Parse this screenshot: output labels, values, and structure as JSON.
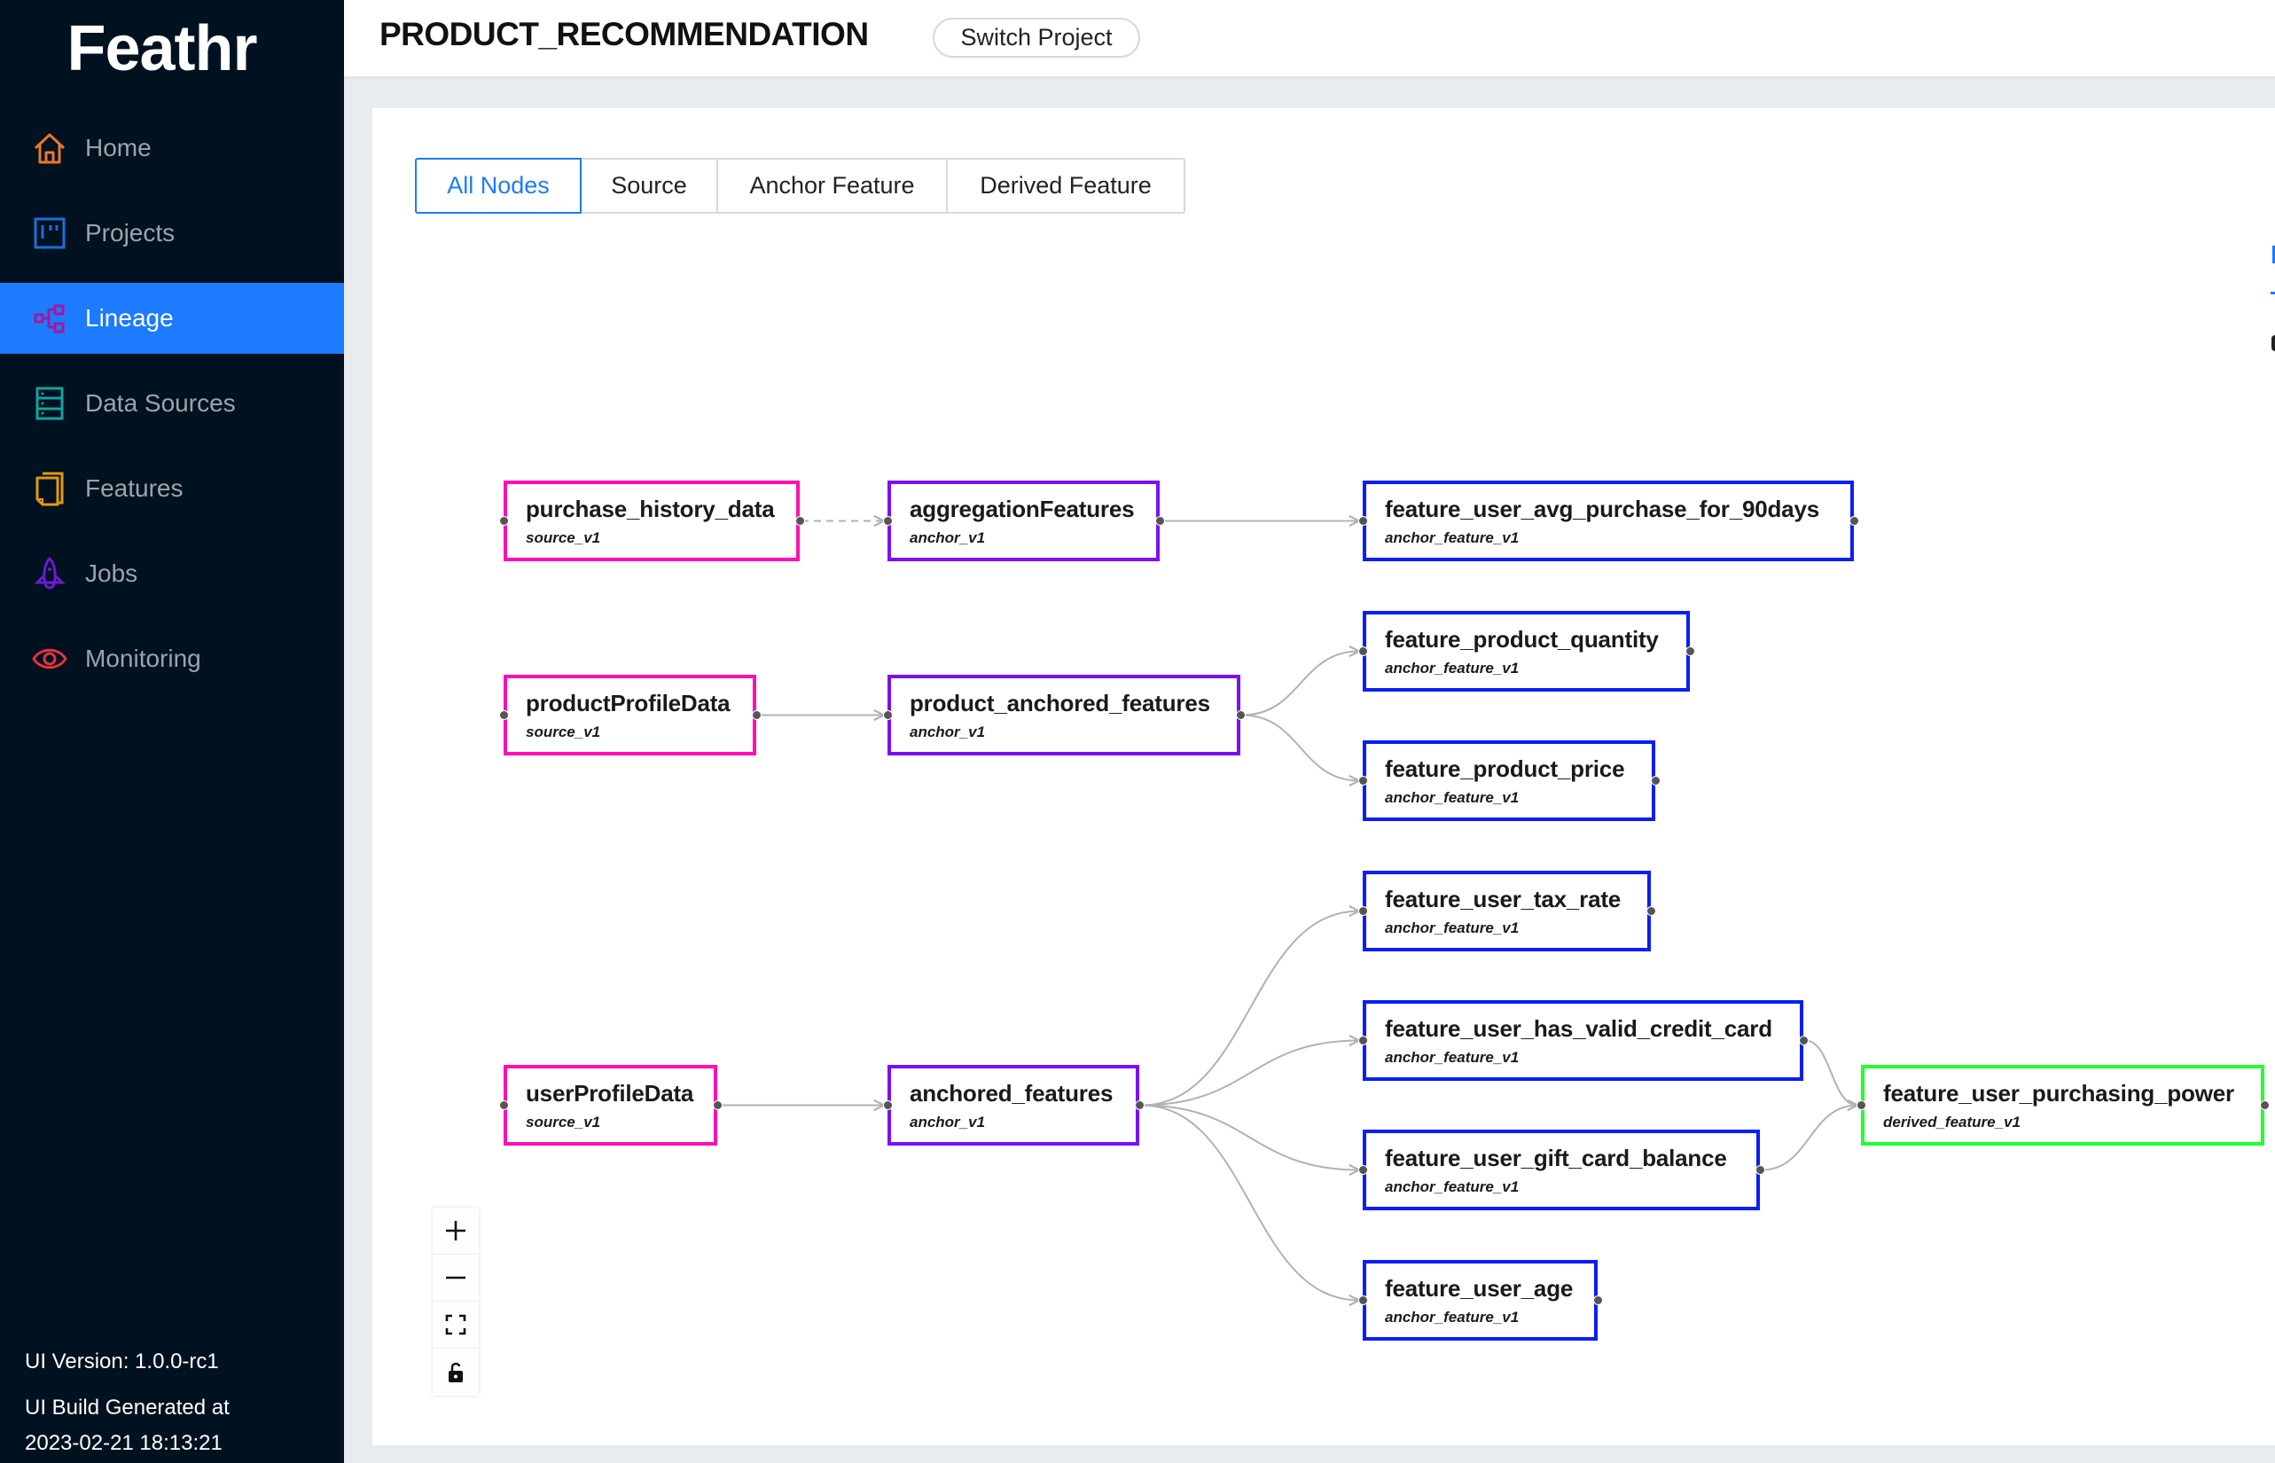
{
  "app": {
    "logo": "Feathr"
  },
  "sidebar": {
    "items": [
      {
        "id": "home",
        "label": "Home",
        "icon": "home-icon",
        "color": "#e8792b",
        "active": false
      },
      {
        "id": "projects",
        "label": "Projects",
        "icon": "projects-board-icon",
        "color": "#1f6fd6",
        "active": false
      },
      {
        "id": "lineage",
        "label": "Lineage",
        "icon": "lineage-icon",
        "color": "#a3199b",
        "active": true
      },
      {
        "id": "data-sources",
        "label": "Data Sources",
        "icon": "database-icon",
        "color": "#13a3a0",
        "active": false
      },
      {
        "id": "features",
        "label": "Features",
        "icon": "copy-document-icon",
        "color": "#e49a0c",
        "active": false
      },
      {
        "id": "jobs",
        "label": "Jobs",
        "icon": "rocket-icon",
        "color": "#6a1bd1",
        "active": false
      },
      {
        "id": "monitoring",
        "label": "Monitoring",
        "icon": "eye-icon",
        "color": "#e3333d",
        "active": false
      }
    ],
    "footer": {
      "version": "UI Version: 1.0.0-rc1",
      "build_label": "UI Build Generated at",
      "build_time": "2023-02-21 18:13:21"
    }
  },
  "header": {
    "project_name": "PRODUCT_RECOMMENDATION",
    "switch_project_label": "Switch Project"
  },
  "filters": {
    "tabs": [
      {
        "label": "All Nodes",
        "active": true
      },
      {
        "label": "Source",
        "active": false
      },
      {
        "label": "Anchor Feature",
        "active": false
      },
      {
        "label": "Derived Feature",
        "active": false
      }
    ]
  },
  "node_type_colors": {
    "source": "#ff0fb4",
    "anchor": "#7a0ff6",
    "anchor_feature": "#0a1ef7",
    "derived_feature": "#22ff33"
  },
  "lineage": {
    "nodes": [
      {
        "id": "purchase_history_data",
        "label": "purchase_history_data",
        "subtitle": "source_v1",
        "type": "source"
      },
      {
        "id": "aggregationFeatures",
        "label": "aggregationFeatures",
        "subtitle": "anchor_v1",
        "type": "anchor"
      },
      {
        "id": "feature_user_avg_purchase_for_90days",
        "label": "feature_user_avg_purchase_for_90days",
        "subtitle": "anchor_feature_v1",
        "type": "anchor_feature"
      },
      {
        "id": "productProfileData",
        "label": "productProfileData",
        "subtitle": "source_v1",
        "type": "source"
      },
      {
        "id": "product_anchored_features",
        "label": "product_anchored_features",
        "subtitle": "anchor_v1",
        "type": "anchor"
      },
      {
        "id": "feature_product_quantity",
        "label": "feature_product_quantity",
        "subtitle": "anchor_feature_v1",
        "type": "anchor_feature"
      },
      {
        "id": "feature_product_price",
        "label": "feature_product_price",
        "subtitle": "anchor_feature_v1",
        "type": "anchor_feature"
      },
      {
        "id": "userProfileData",
        "label": "userProfileData",
        "subtitle": "source_v1",
        "type": "source"
      },
      {
        "id": "anchored_features",
        "label": "anchored_features",
        "subtitle": "anchor_v1",
        "type": "anchor"
      },
      {
        "id": "feature_user_tax_rate",
        "label": "feature_user_tax_rate",
        "subtitle": "anchor_feature_v1",
        "type": "anchor_feature"
      },
      {
        "id": "feature_user_has_valid_credit_card",
        "label": "feature_user_has_valid_credit_card",
        "subtitle": "anchor_feature_v1",
        "type": "anchor_feature"
      },
      {
        "id": "feature_user_gift_card_balance",
        "label": "feature_user_gift_card_balance",
        "subtitle": "anchor_feature_v1",
        "type": "anchor_feature"
      },
      {
        "id": "feature_user_age",
        "label": "feature_user_age",
        "subtitle": "anchor_feature_v1",
        "type": "anchor_feature"
      },
      {
        "id": "feature_user_purchasing_power",
        "label": "feature_user_purchasing_power",
        "subtitle": "derived_feature_v1",
        "type": "derived_feature"
      }
    ],
    "edges": [
      {
        "from": "purchase_history_data",
        "to": "aggregationFeatures",
        "style": "dashed"
      },
      {
        "from": "aggregationFeatures",
        "to": "feature_user_avg_purchase_for_90days",
        "style": "solid"
      },
      {
        "from": "productProfileData",
        "to": "product_anchored_features",
        "style": "solid"
      },
      {
        "from": "product_anchored_features",
        "to": "feature_product_quantity",
        "style": "solid"
      },
      {
        "from": "product_anchored_features",
        "to": "feature_product_price",
        "style": "solid"
      },
      {
        "from": "userProfileData",
        "to": "anchored_features",
        "style": "solid"
      },
      {
        "from": "anchored_features",
        "to": "feature_user_tax_rate",
        "style": "solid"
      },
      {
        "from": "anchored_features",
        "to": "feature_user_has_valid_credit_card",
        "style": "solid"
      },
      {
        "from": "anchored_features",
        "to": "feature_user_gift_card_balance",
        "style": "solid"
      },
      {
        "from": "anchored_features",
        "to": "feature_user_age",
        "style": "solid"
      },
      {
        "from": "feature_user_has_valid_credit_card",
        "to": "feature_user_purchasing_power",
        "style": "solid"
      },
      {
        "from": "feature_user_gift_card_balance",
        "to": "feature_user_purchasing_power",
        "style": "solid"
      }
    ]
  },
  "graph_controls": [
    {
      "id": "zoom-in",
      "icon": "plus-icon"
    },
    {
      "id": "zoom-out",
      "icon": "minus-icon"
    },
    {
      "id": "fit-view",
      "icon": "fit-view-icon"
    },
    {
      "id": "toggle-interactivity",
      "icon": "unlock-icon"
    }
  ]
}
